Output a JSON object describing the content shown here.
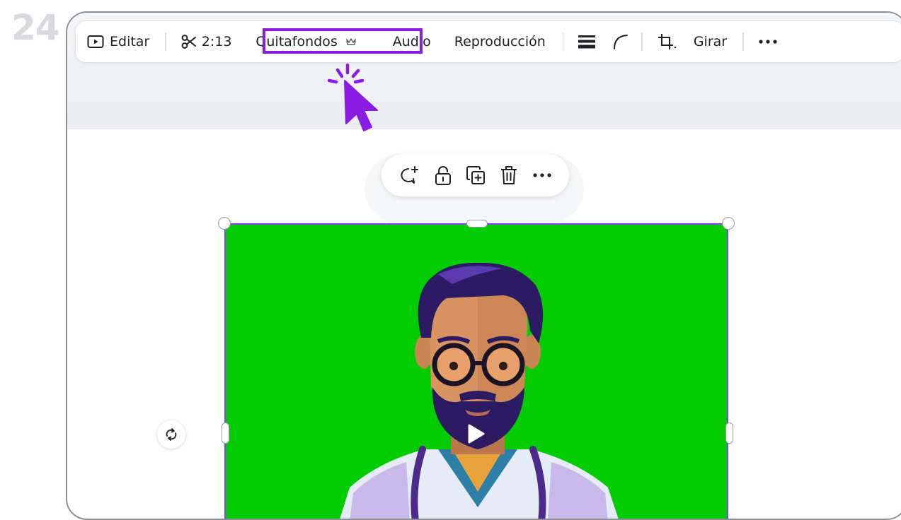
{
  "step": {
    "number": "24"
  },
  "toolbar": {
    "edit_label": "Editar",
    "duration_label": "2:13",
    "bg_remover_label": "Quitafondos",
    "audio_label": "Audio",
    "playback_label": "Reproducción",
    "rotate_label": "Girar",
    "icons": [
      "play-box-icon",
      "scissors-icon",
      "crown-icon",
      "line-weight-icon",
      "corner-radius-icon",
      "crop-icon",
      "more-icon"
    ]
  },
  "element_toolbar": {
    "icons": [
      "comment-add-icon",
      "lock-icon",
      "duplicate-icon",
      "delete-icon",
      "more-icon"
    ]
  },
  "video": {
    "background_color": "#03cd00",
    "subject": "illustrated bearded doctor with glasses and stethoscope"
  },
  "colors": {
    "highlight": "#8a1be3",
    "selection": "#8b3dff",
    "cursor": "#8a1be3"
  }
}
